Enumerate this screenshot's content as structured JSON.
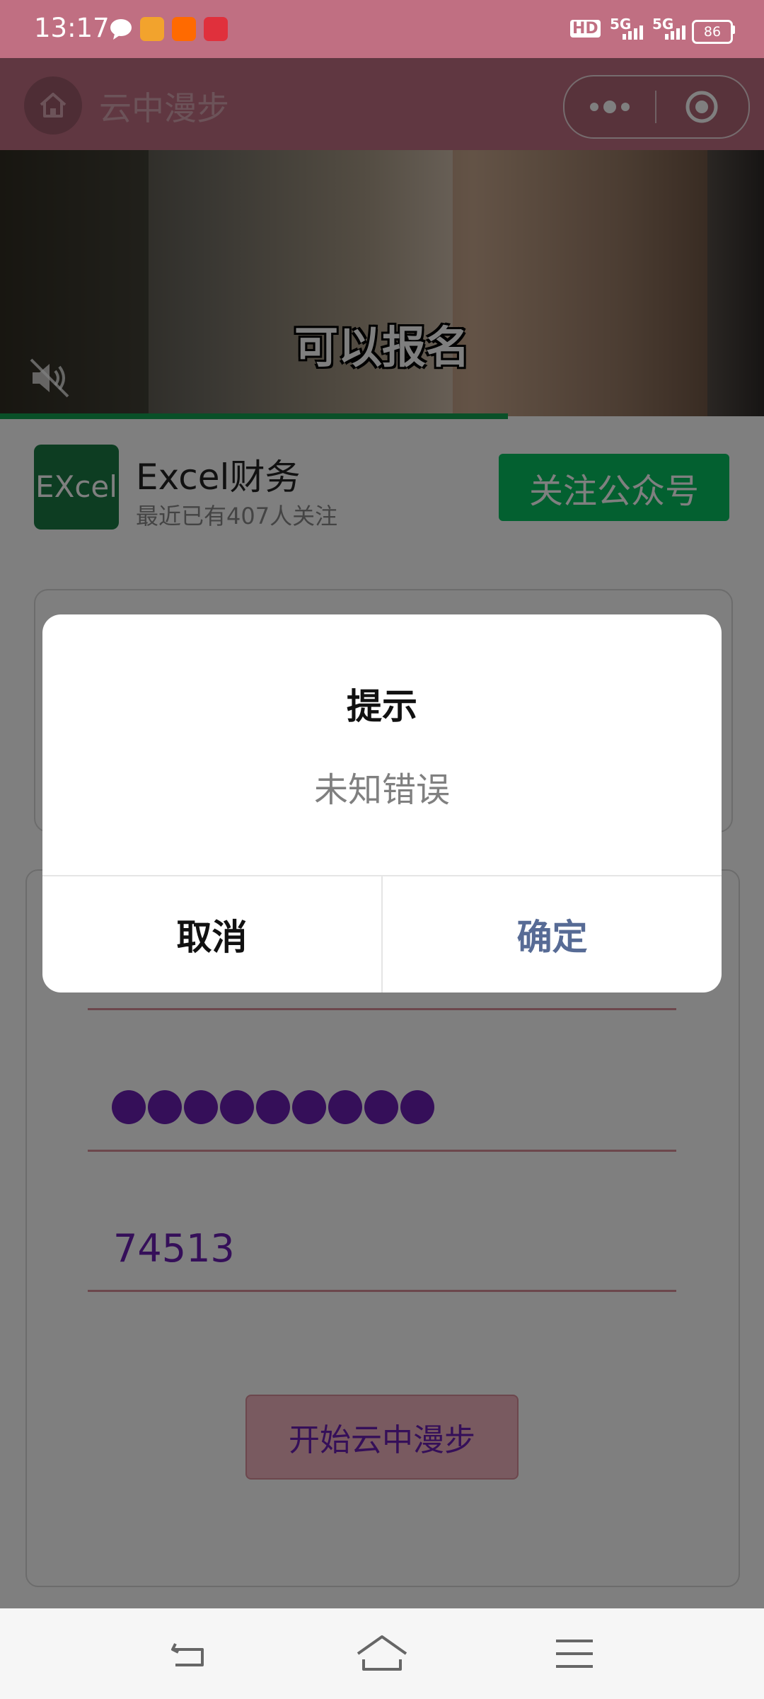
{
  "status_bar": {
    "time": "13:17",
    "battery": "86",
    "network_1": "5G",
    "network_2": "5G",
    "hd": "HD",
    "notification_icons": [
      "message-bubble-icon",
      "lion-app-icon",
      "taobao-icon",
      "toutiao-icon"
    ]
  },
  "navbar": {
    "title": "云中漫步"
  },
  "video": {
    "subtitle": "可以报名",
    "progress": 0.665
  },
  "account": {
    "logo_text": "EXcel",
    "name": "Excel财务",
    "subtitle": "最近已有407人关注",
    "follow_label": "关注公众号"
  },
  "form": {
    "password_dot_count": 9,
    "code_value": "74513",
    "start_label": "开始云中漫步"
  },
  "modal": {
    "title": "提示",
    "content": "未知错误",
    "cancel_label": "取消",
    "confirm_label": "确定"
  },
  "colors": {
    "brand_bar": "#c06f82",
    "wechat_green": "#07c160",
    "accent_purple": "#6a1fb3",
    "confirm_blue": "#576b95"
  }
}
